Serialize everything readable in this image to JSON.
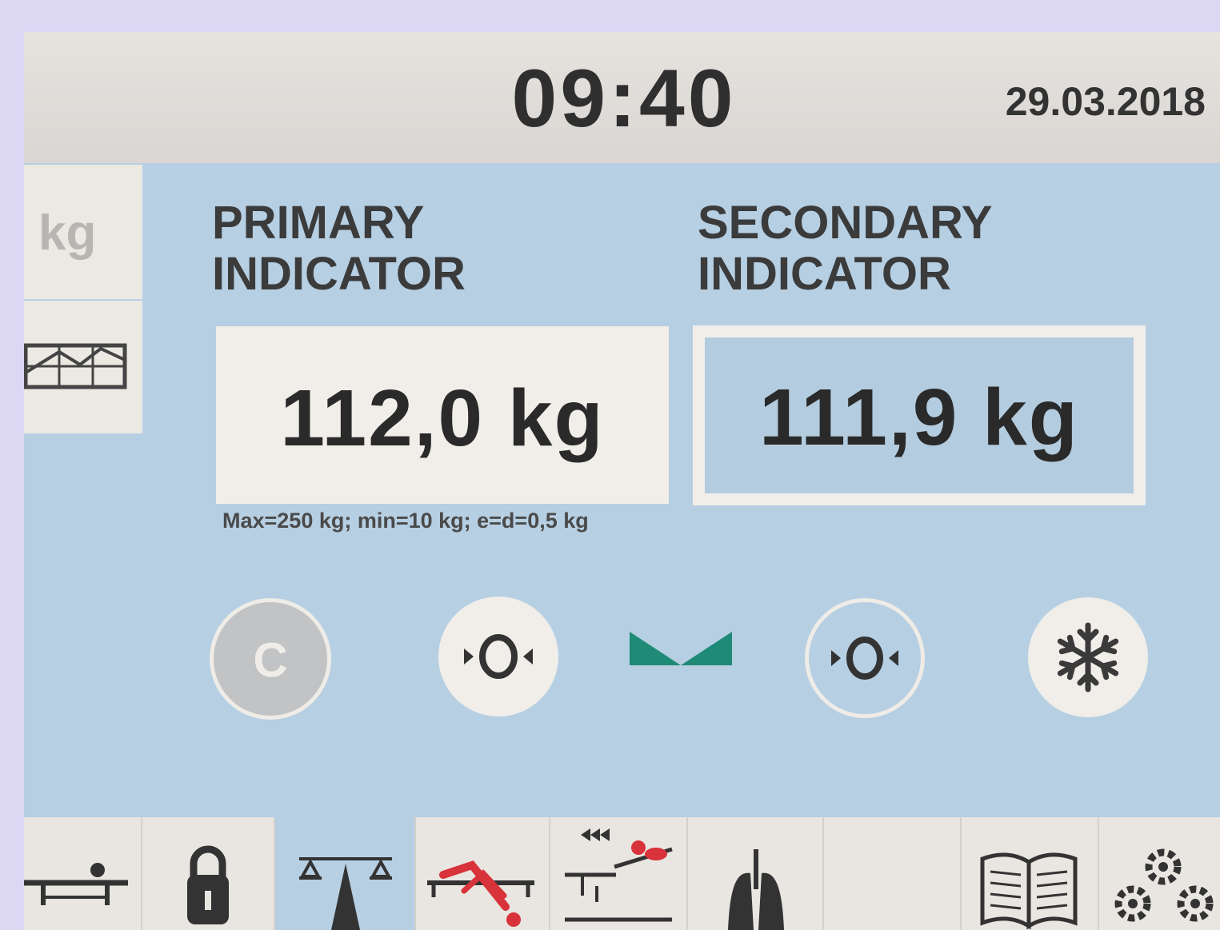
{
  "header": {
    "time": "09:40",
    "date": "29.03.2018"
  },
  "sidebar": {
    "unit_tab": "kg",
    "graph_tab_icon": "weight-graph-icon"
  },
  "primary": {
    "label_line1": "PRIMARY",
    "label_line2": "INDICATOR",
    "value": "112,0 kg",
    "spec": "Max=250 kg; min=10 kg; e=d=0,5 kg"
  },
  "secondary": {
    "label_line1": "SECONDARY",
    "label_line2": "INDICATOR",
    "value": "111,9 kg"
  },
  "controls": {
    "clear_label": "C",
    "zero_primary_icon": "zero-icon",
    "stable_icon": "stable-icon",
    "zero_secondary_icon": "zero-icon",
    "freeze_icon": "snowflake-icon"
  },
  "bottom_bar": {
    "items": [
      "bed-icon",
      "lock-icon",
      "balance-icon",
      "patient-fall-icon",
      "patient-position-icon",
      "lungs-icon",
      "blank",
      "manual-icon",
      "settings-gears-icon"
    ]
  },
  "colors": {
    "screen_bg": "#b6cfe3",
    "panel": "#f1eee9",
    "stable_indicator": "#1f8a76",
    "alert_red": "#d8323a"
  }
}
